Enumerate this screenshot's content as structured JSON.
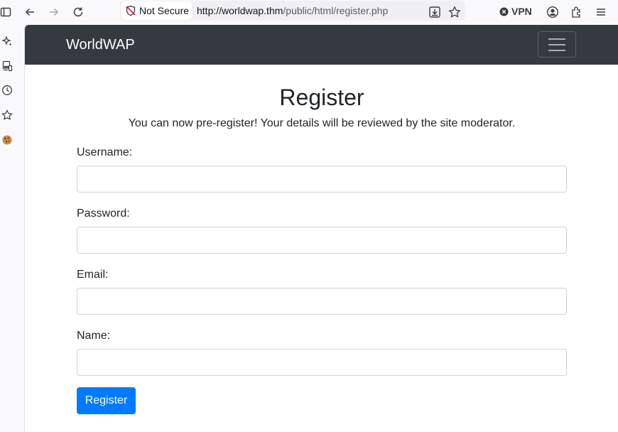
{
  "browser": {
    "security_label": "Not Secure",
    "url_host": "http://worldwap.thm",
    "url_path": "/public/html/register.php",
    "vpn_label": "VPN",
    "icons": [
      "sidebar-toggle-icon",
      "back-icon",
      "forward-icon",
      "reload-icon",
      "shield-slash-icon",
      "download-icon",
      "bookmark-star-icon",
      "vpn-icon",
      "account-icon",
      "extensions-icon",
      "menu-icon"
    ]
  },
  "sidebar": {
    "icons": [
      "ai-sparkle-icon",
      "synced-tabs-icon",
      "history-icon",
      "bookmarks-icon",
      "cookie-icon"
    ]
  },
  "navbar": {
    "brand": "WorldWAP",
    "toggler_icon": "hamburger-icon"
  },
  "main": {
    "title": "Register",
    "subtitle": "You can now pre-register! Your details will be reviewed by the site moderator.",
    "fields": [
      {
        "label": "Username:",
        "value": ""
      },
      {
        "label": "Password:",
        "value": ""
      },
      {
        "label": "Email:",
        "value": ""
      },
      {
        "label": "Name:",
        "value": ""
      }
    ],
    "submit_label": "Register"
  },
  "colors": {
    "navbar_bg": "#343a40",
    "primary": "#007bff",
    "text": "#212529"
  }
}
